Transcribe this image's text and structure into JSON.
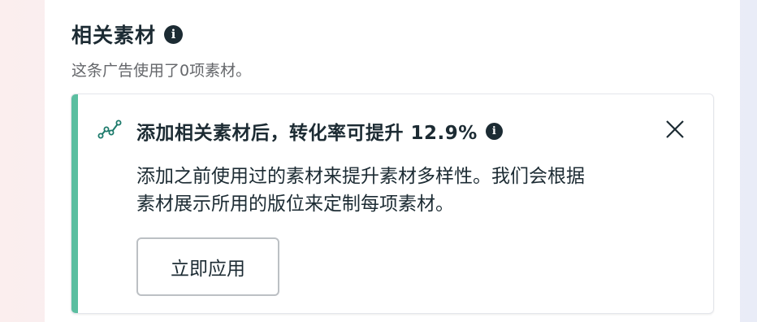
{
  "section": {
    "title": "相关素材",
    "info_icon": "info-icon",
    "subtitle": "这条广告使用了0项素材。"
  },
  "recommendation": {
    "icon": "trend-line-icon",
    "title": "添加相关素材后，转化率可提升 12.9%",
    "info_icon": "info-icon",
    "close_icon": "close-icon",
    "body_line1": "添加之前使用过的素材来提升素材多样性。我们会根据",
    "body_line2": "素材展示所用的版位来定制每项素材。",
    "apply_label": "立即应用",
    "accent_color": "#5bbea0"
  }
}
